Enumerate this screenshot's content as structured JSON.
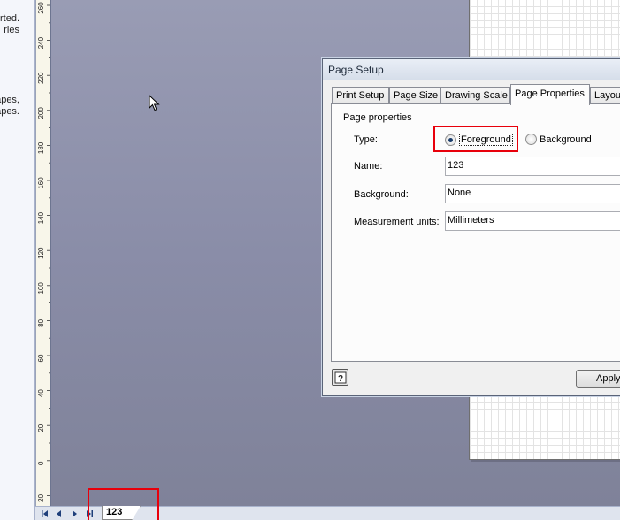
{
  "left_panel": {
    "snippets": [
      "rted.",
      "ries",
      "apes,",
      "apes."
    ]
  },
  "ruler": {
    "labels": [
      "260",
      "240",
      "220",
      "200",
      "180",
      "160",
      "140",
      "120",
      "100",
      "80",
      "60",
      "40",
      "20",
      "0",
      "20"
    ]
  },
  "tab_bar": {
    "nav_icons": [
      "first-page-icon",
      "prev-page-icon",
      "next-page-icon",
      "last-page-icon"
    ],
    "page_tab": "123"
  },
  "dialog": {
    "title": "Page Setup",
    "tabs": [
      "Print Setup",
      "Page Size",
      "Drawing Scale",
      "Page Properties",
      "Layou"
    ],
    "active_tab": "Page Properties",
    "group_label": "Page properties",
    "type": {
      "label": "Type:",
      "options": [
        "Foreground",
        "Background"
      ],
      "selected": "Foreground"
    },
    "name": {
      "label": "Name:",
      "value": "123"
    },
    "background": {
      "label": "Background:",
      "value": "None"
    },
    "measurement_units": {
      "label": "Measurement units:",
      "value": "Millimeters"
    },
    "help_icon": "help-icon",
    "apply_label": "Apply"
  },
  "colors": {
    "highlight": "#e8000b",
    "canvas": "#8a8ea6"
  }
}
